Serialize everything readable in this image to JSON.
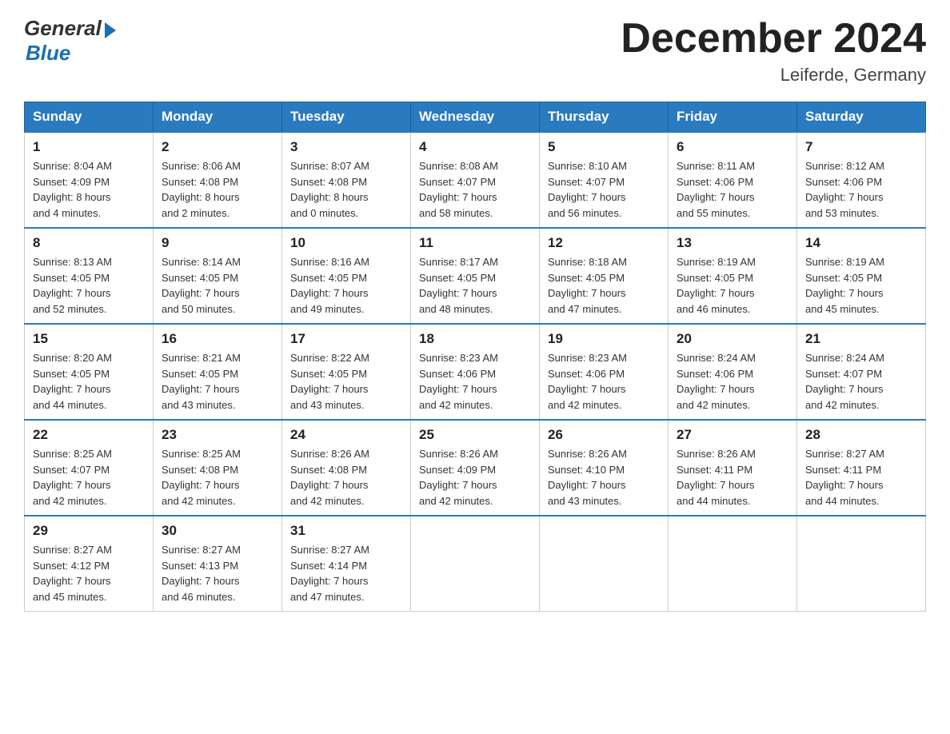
{
  "header": {
    "logo_general": "General",
    "logo_blue": "Blue",
    "month_title": "December 2024",
    "location": "Leiferde, Germany"
  },
  "weekdays": [
    "Sunday",
    "Monday",
    "Tuesday",
    "Wednesday",
    "Thursday",
    "Friday",
    "Saturday"
  ],
  "weeks": [
    [
      {
        "day": "1",
        "sunrise": "8:04 AM",
        "sunset": "4:09 PM",
        "daylight": "8 hours and 4 minutes."
      },
      {
        "day": "2",
        "sunrise": "8:06 AM",
        "sunset": "4:08 PM",
        "daylight": "8 hours and 2 minutes."
      },
      {
        "day": "3",
        "sunrise": "8:07 AM",
        "sunset": "4:08 PM",
        "daylight": "8 hours and 0 minutes."
      },
      {
        "day": "4",
        "sunrise": "8:08 AM",
        "sunset": "4:07 PM",
        "daylight": "7 hours and 58 minutes."
      },
      {
        "day": "5",
        "sunrise": "8:10 AM",
        "sunset": "4:07 PM",
        "daylight": "7 hours and 56 minutes."
      },
      {
        "day": "6",
        "sunrise": "8:11 AM",
        "sunset": "4:06 PM",
        "daylight": "7 hours and 55 minutes."
      },
      {
        "day": "7",
        "sunrise": "8:12 AM",
        "sunset": "4:06 PM",
        "daylight": "7 hours and 53 minutes."
      }
    ],
    [
      {
        "day": "8",
        "sunrise": "8:13 AM",
        "sunset": "4:05 PM",
        "daylight": "7 hours and 52 minutes."
      },
      {
        "day": "9",
        "sunrise": "8:14 AM",
        "sunset": "4:05 PM",
        "daylight": "7 hours and 50 minutes."
      },
      {
        "day": "10",
        "sunrise": "8:16 AM",
        "sunset": "4:05 PM",
        "daylight": "7 hours and 49 minutes."
      },
      {
        "day": "11",
        "sunrise": "8:17 AM",
        "sunset": "4:05 PM",
        "daylight": "7 hours and 48 minutes."
      },
      {
        "day": "12",
        "sunrise": "8:18 AM",
        "sunset": "4:05 PM",
        "daylight": "7 hours and 47 minutes."
      },
      {
        "day": "13",
        "sunrise": "8:19 AM",
        "sunset": "4:05 PM",
        "daylight": "7 hours and 46 minutes."
      },
      {
        "day": "14",
        "sunrise": "8:19 AM",
        "sunset": "4:05 PM",
        "daylight": "7 hours and 45 minutes."
      }
    ],
    [
      {
        "day": "15",
        "sunrise": "8:20 AM",
        "sunset": "4:05 PM",
        "daylight": "7 hours and 44 minutes."
      },
      {
        "day": "16",
        "sunrise": "8:21 AM",
        "sunset": "4:05 PM",
        "daylight": "7 hours and 43 minutes."
      },
      {
        "day": "17",
        "sunrise": "8:22 AM",
        "sunset": "4:05 PM",
        "daylight": "7 hours and 43 minutes."
      },
      {
        "day": "18",
        "sunrise": "8:23 AM",
        "sunset": "4:06 PM",
        "daylight": "7 hours and 42 minutes."
      },
      {
        "day": "19",
        "sunrise": "8:23 AM",
        "sunset": "4:06 PM",
        "daylight": "7 hours and 42 minutes."
      },
      {
        "day": "20",
        "sunrise": "8:24 AM",
        "sunset": "4:06 PM",
        "daylight": "7 hours and 42 minutes."
      },
      {
        "day": "21",
        "sunrise": "8:24 AM",
        "sunset": "4:07 PM",
        "daylight": "7 hours and 42 minutes."
      }
    ],
    [
      {
        "day": "22",
        "sunrise": "8:25 AM",
        "sunset": "4:07 PM",
        "daylight": "7 hours and 42 minutes."
      },
      {
        "day": "23",
        "sunrise": "8:25 AM",
        "sunset": "4:08 PM",
        "daylight": "7 hours and 42 minutes."
      },
      {
        "day": "24",
        "sunrise": "8:26 AM",
        "sunset": "4:08 PM",
        "daylight": "7 hours and 42 minutes."
      },
      {
        "day": "25",
        "sunrise": "8:26 AM",
        "sunset": "4:09 PM",
        "daylight": "7 hours and 42 minutes."
      },
      {
        "day": "26",
        "sunrise": "8:26 AM",
        "sunset": "4:10 PM",
        "daylight": "7 hours and 43 minutes."
      },
      {
        "day": "27",
        "sunrise": "8:26 AM",
        "sunset": "4:11 PM",
        "daylight": "7 hours and 44 minutes."
      },
      {
        "day": "28",
        "sunrise": "8:27 AM",
        "sunset": "4:11 PM",
        "daylight": "7 hours and 44 minutes."
      }
    ],
    [
      {
        "day": "29",
        "sunrise": "8:27 AM",
        "sunset": "4:12 PM",
        "daylight": "7 hours and 45 minutes."
      },
      {
        "day": "30",
        "sunrise": "8:27 AM",
        "sunset": "4:13 PM",
        "daylight": "7 hours and 46 minutes."
      },
      {
        "day": "31",
        "sunrise": "8:27 AM",
        "sunset": "4:14 PM",
        "daylight": "7 hours and 47 minutes."
      },
      null,
      null,
      null,
      null
    ]
  ],
  "labels": {
    "sunrise": "Sunrise:",
    "sunset": "Sunset:",
    "daylight": "Daylight:"
  }
}
